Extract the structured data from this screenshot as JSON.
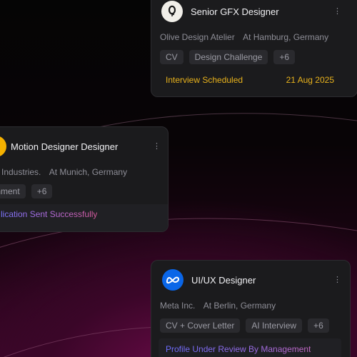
{
  "cards": [
    {
      "title": "Senior GFX Designer",
      "company": "Olive Design Atelier",
      "location": "At Hamburg, Germany",
      "tags": [
        "CV",
        "Design Challenge",
        "+6"
      ],
      "status": "Interview Scheduled",
      "date": "21 Aug 2025",
      "logo_icon": "olive-logo-icon",
      "status_color": "#e8b21c"
    },
    {
      "title": "Motion Designer Designer",
      "company": "Industries.",
      "location": "At Munich, Germany",
      "tags": [
        "ignment",
        "+6"
      ],
      "status": "lication Sent Successfully",
      "logo_icon": "orange-circle-logo-icon"
    },
    {
      "title": "UI/UX Designer",
      "company": "Meta Inc.",
      "location": "At Berlin, Germany",
      "tags": [
        "CV + Cover Letter",
        "AI Interview",
        "+6"
      ],
      "status": "Profile Under Review By Management",
      "logo_icon": "meta-logo-icon",
      "accent": "#0a66e8"
    }
  ]
}
